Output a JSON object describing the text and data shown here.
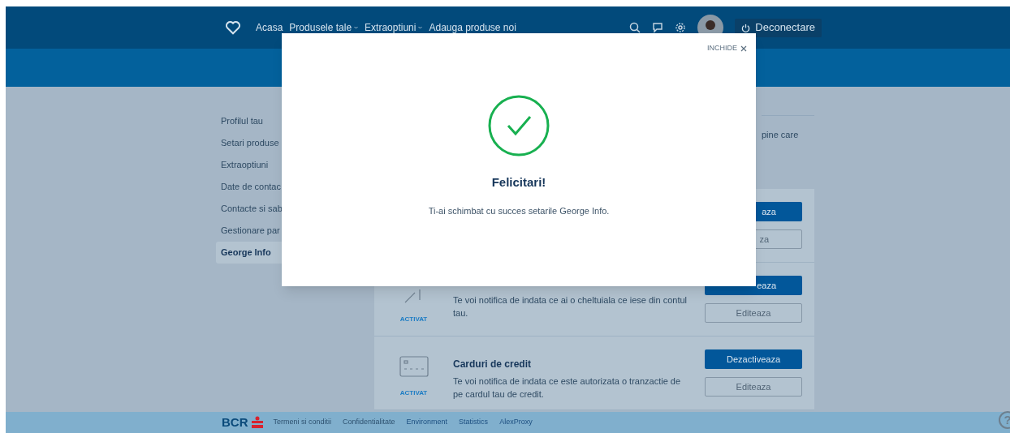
{
  "header": {
    "nav": [
      {
        "label": "Acasa",
        "dropdown": false
      },
      {
        "label": "Produsele tale",
        "dropdown": true
      },
      {
        "label": "Extraoptiuni",
        "dropdown": true
      },
      {
        "label": "Adauga produse noi",
        "dropdown": false
      }
    ],
    "logout": "Deconectare"
  },
  "sidebar": {
    "items": [
      {
        "label": "Profilul tau",
        "selected": false
      },
      {
        "label": "Setari produse",
        "selected": false
      },
      {
        "label": "Extraoptiuni",
        "selected": false
      },
      {
        "label": "Date de contac",
        "selected": false
      },
      {
        "label": "Contacte si sab",
        "selected": false
      },
      {
        "label": "Gestionare par",
        "selected": false
      },
      {
        "label": "George Info",
        "selected": true
      }
    ]
  },
  "intro": "pine care",
  "notifications": [
    {
      "kind": "hidden",
      "primary": "aza",
      "secondary": "za"
    },
    {
      "kind": "spending",
      "description": "Te voi notifica de indata ce ai o cheltuiala ce iese din contul tau.",
      "status": "ACTIVAT",
      "primary": "eaza",
      "secondary": "Editeaza"
    },
    {
      "kind": "card",
      "title": "Carduri de credit",
      "description": "Te voi notifica de indata ce este autorizata o tranzactie de pe cardul tau de credit.",
      "status": "ACTIVAT",
      "primary": "Dezactiveaza",
      "secondary": "Editeaza"
    }
  ],
  "modal": {
    "close": "INCHIDE",
    "title": "Felicitari!",
    "message": "Ti-ai schimbat cu succes setarile George Info."
  },
  "footer": {
    "logo": "BCR",
    "links": [
      "Termeni si conditii",
      "Confidentialitate",
      "Environment",
      "Statistics",
      "AlexProxy"
    ],
    "help": "?"
  }
}
